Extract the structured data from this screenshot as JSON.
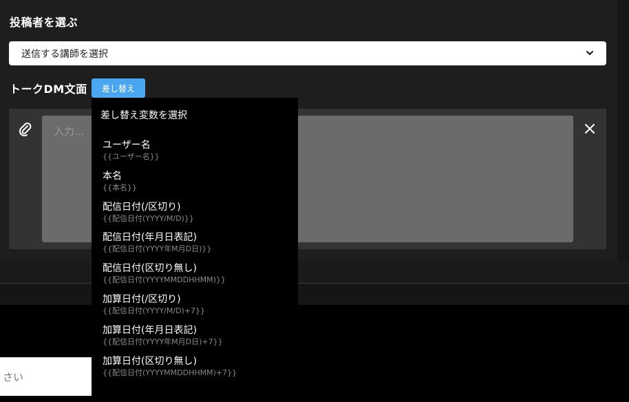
{
  "poster": {
    "heading": "投稿者を選ぶ",
    "select_value": "送信する講師を選択"
  },
  "message": {
    "heading": "トークDM文面",
    "swap_button": "差し替え",
    "placeholder": "入力..."
  },
  "dropdown": {
    "title": "差し替え変数を選択",
    "items": [
      {
        "label": "ユーザー名",
        "code": "{{ユーザー名}}"
      },
      {
        "label": "本名",
        "code": "{{本名}}"
      },
      {
        "label": "配信日付(/区切り)",
        "code": "{{配信日付(YYYY/M/D)}}"
      },
      {
        "label": "配信日付(年月日表記)",
        "code": "{{配信日付(YYYY年M月D日)}}"
      },
      {
        "label": "配信日付(区切り無し)",
        "code": "{{配信日付(YYYYMMDDHHMM)}}"
      },
      {
        "label": "加算日付(/区切り)",
        "code": "{{配信日付(YYYY/M/D)+7}}"
      },
      {
        "label": "加算日付(年月日表記)",
        "code": "{{配信日付(YYYY年M月D日)+7}}"
      },
      {
        "label": "加算日付(区切り無し)",
        "code": "{{配信日付(YYYYMMDDHHMM)+7}}"
      }
    ]
  },
  "footer": {
    "input_fragment": "さい"
  },
  "icons": {
    "select_chevron": "chevron-down-icon",
    "attach": "paperclip-icon",
    "close": "close-icon"
  },
  "colors": {
    "accent": "#4aa6f0",
    "panel_bg": "#1e1e1e",
    "editor_bg": "#333333",
    "textarea_bg": "#6b6b6b"
  }
}
